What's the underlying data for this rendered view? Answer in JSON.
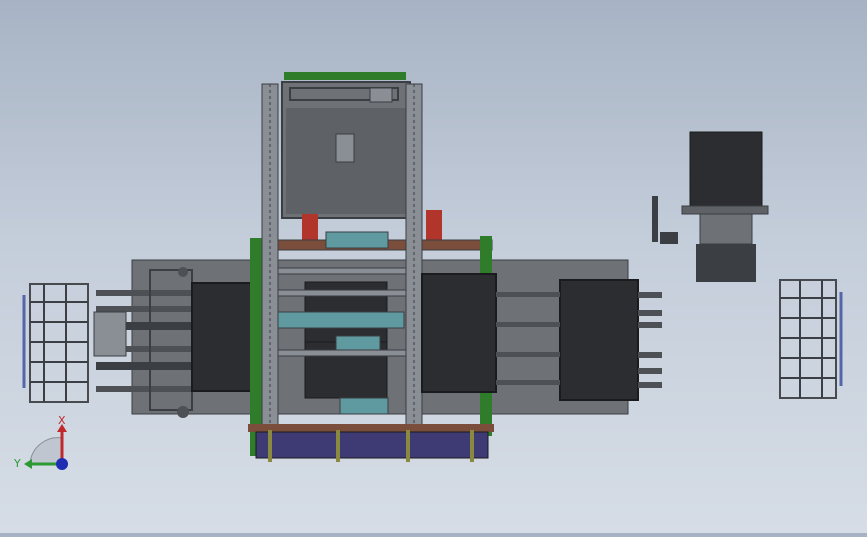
{
  "viewport": {
    "background_top": "#a7b3c4",
    "background_bottom": "#d6dde6",
    "model_colors": {
      "frame": "#8a8f96",
      "frame_dark": "#3b3e42",
      "plate": "#6e7277",
      "panel_black": "#2b2d30",
      "green": "#2f7d2a",
      "teal": "#5f9aa0",
      "navy": "#3d3a74",
      "rust": "#7a4e3a",
      "red": "#b1352b"
    }
  },
  "triad": {
    "x_label": "X",
    "y_label": "Y",
    "x_color": "#c0282c",
    "y_color": "#2c9a34",
    "z_color": "#1f2db2"
  }
}
